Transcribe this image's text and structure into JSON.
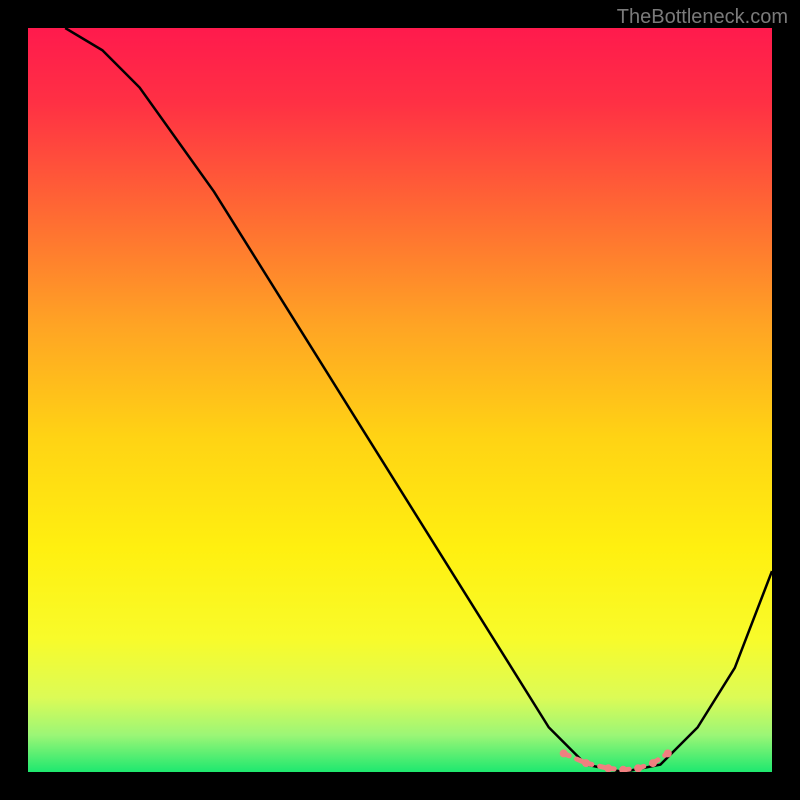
{
  "watermark": "TheBottleneck.com",
  "chart_data": {
    "type": "line",
    "title": "",
    "xlabel": "",
    "ylabel": "",
    "xlim": [
      0,
      100
    ],
    "ylim": [
      0,
      100
    ],
    "grid": false,
    "series": [
      {
        "name": "curve",
        "color": "#000000",
        "x": [
          5,
          10,
          15,
          20,
          25,
          30,
          35,
          40,
          45,
          50,
          55,
          60,
          65,
          70,
          75,
          80,
          85,
          90,
          95,
          100
        ],
        "y": [
          100,
          97,
          92,
          85,
          78,
          70,
          62,
          54,
          46,
          38,
          30,
          22,
          14,
          6,
          1,
          0,
          1,
          6,
          14,
          27
        ]
      },
      {
        "name": "minimum-band",
        "color": "#f08080",
        "x": [
          72,
          75,
          78,
          80,
          82,
          84,
          86
        ],
        "y": [
          2.5,
          1.2,
          0.5,
          0.3,
          0.5,
          1.2,
          2.5
        ]
      }
    ],
    "gradient_stops": [
      {
        "offset": 0.0,
        "color": "#ff1a4d"
      },
      {
        "offset": 0.1,
        "color": "#ff3044"
      },
      {
        "offset": 0.25,
        "color": "#ff6a33"
      },
      {
        "offset": 0.4,
        "color": "#ffa424"
      },
      {
        "offset": 0.55,
        "color": "#ffd314"
      },
      {
        "offset": 0.7,
        "color": "#fff010"
      },
      {
        "offset": 0.82,
        "color": "#f8fb2a"
      },
      {
        "offset": 0.9,
        "color": "#dcfb56"
      },
      {
        "offset": 0.95,
        "color": "#9cf676"
      },
      {
        "offset": 1.0,
        "color": "#1ee86f"
      }
    ]
  }
}
